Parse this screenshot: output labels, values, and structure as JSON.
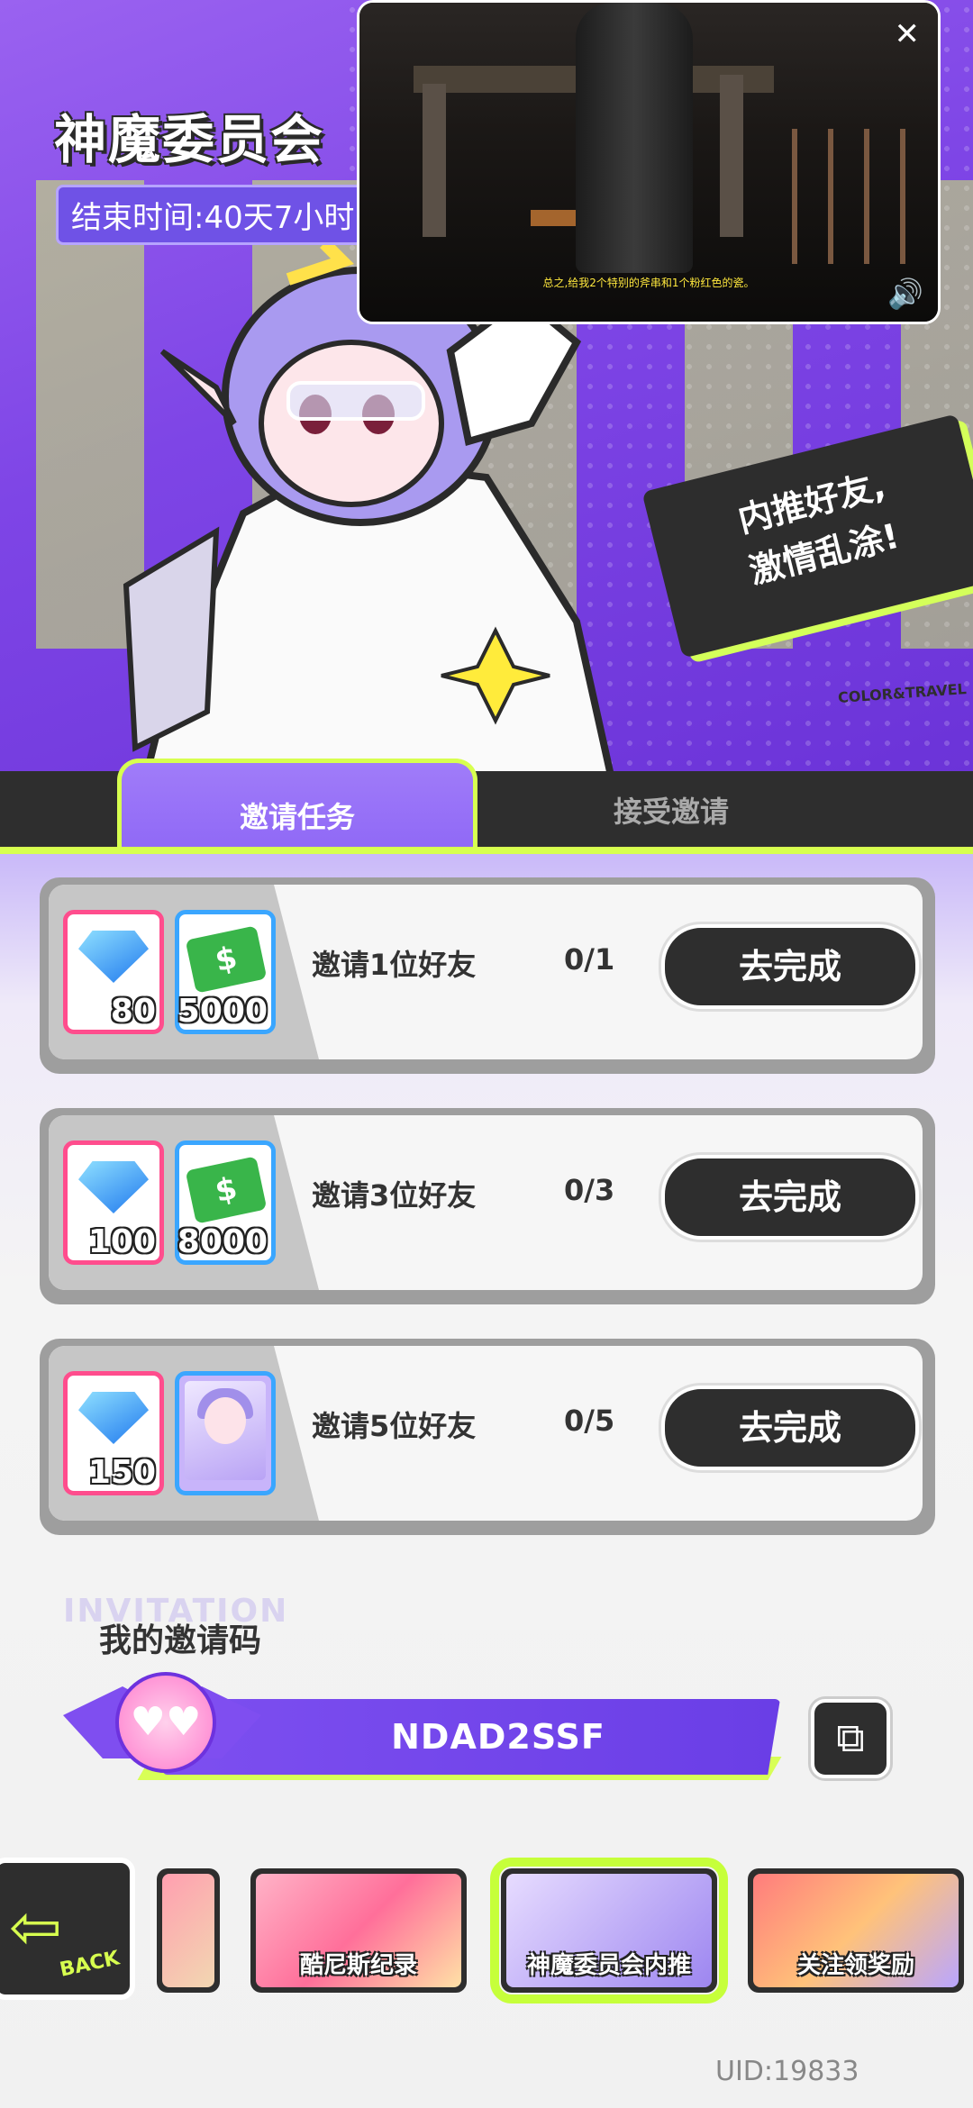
{
  "header": {
    "title": "神魔委员会",
    "end_time": "结束时间:40天7小时",
    "speech_line1": "内推好友,",
    "speech_line2": "激情乱涂!",
    "brand": "COLOR&TRAVEL"
  },
  "video": {
    "caption": "总之,给我2个特别的斧串和1个粉红色的瓷。",
    "close_icon": "close-icon",
    "sound_icon": "speaker-icon"
  },
  "tabs": [
    {
      "label": "邀请任务",
      "active": true
    },
    {
      "label": "接受邀请",
      "active": false
    }
  ],
  "tasks": [
    {
      "label": "邀请1位好友",
      "progress": "0/1",
      "button": "去完成",
      "rewards": [
        "80",
        "5000"
      ]
    },
    {
      "label": "邀请3位好友",
      "progress": "0/3",
      "button": "去完成",
      "rewards": [
        "100",
        "8000"
      ]
    },
    {
      "label": "邀请5位好友",
      "progress": "0/5",
      "button": "去完成",
      "rewards": [
        "150",
        ""
      ]
    }
  ],
  "invitation": {
    "watermark": "INVITATION",
    "title": "我的邀请码",
    "code": "NDAD2SSF",
    "copy_icon": "copy-icon"
  },
  "nav": {
    "back": "BACK",
    "items": [
      "酷尼斯纪录",
      "神魔委员会内推",
      "关注领奖励"
    ]
  },
  "uid": "UID:19833",
  "colors": {
    "accent": "#d7ff4f",
    "purple": "#8f68f6",
    "dark": "#2e2e2e"
  }
}
